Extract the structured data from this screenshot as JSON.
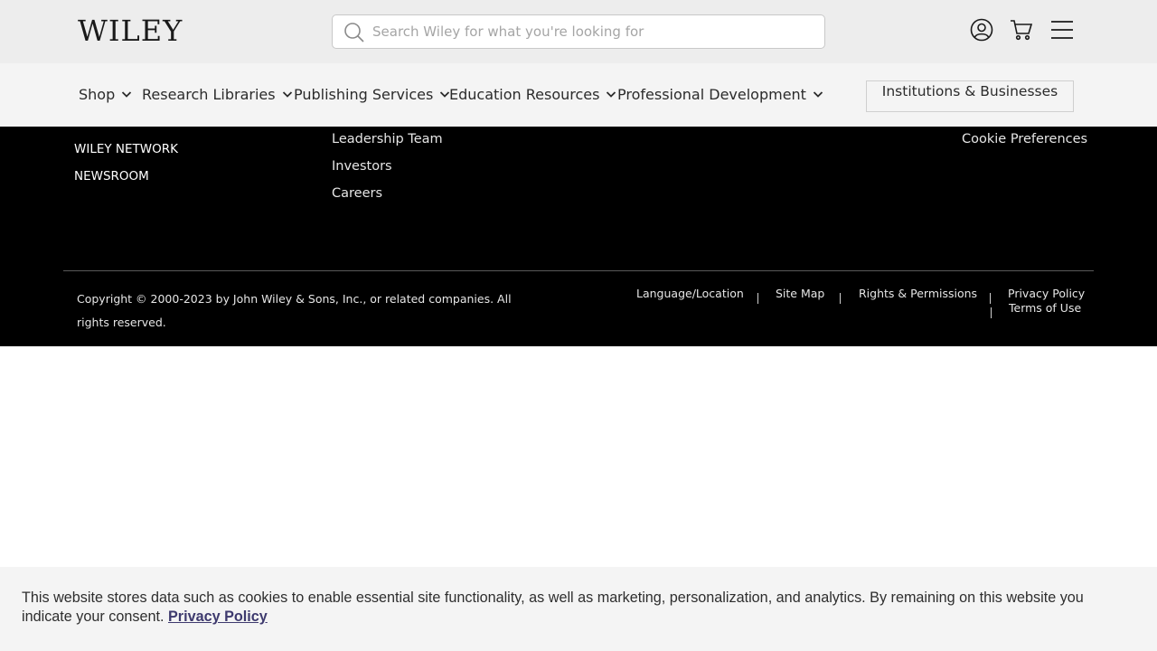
{
  "header": {
    "logo_text": "WILEY",
    "search": {
      "placeholder": "Search Wiley for what you're looking for",
      "value": ""
    },
    "icons": [
      "account-icon",
      "cart-icon",
      "menu-icon"
    ]
  },
  "nav": {
    "items": [
      {
        "label": "Shop"
      },
      {
        "label": "Research Libraries"
      },
      {
        "label": "Publishing Services"
      },
      {
        "label": "Education Resources"
      },
      {
        "label": "Professional Development"
      }
    ],
    "institutions_button": "Institutions & Businesses"
  },
  "footer": {
    "col1": [
      "WILEY NETWORK",
      "NEWSROOM"
    ],
    "col2": [
      "Leadership Team",
      "Investors",
      "Careers"
    ],
    "col4": [
      "Cookie Preferences"
    ],
    "copyright": "Copyright © 2000-2023 by John Wiley & Sons, Inc., or related companies. All rights reserved.",
    "legal_links": [
      "Language/Location",
      "Site Map",
      "Rights & Permissions",
      "Privacy Policy",
      "Terms of Use"
    ]
  },
  "cookie_banner": {
    "text": "This website stores data such as cookies to enable essential site functionality, as well as marketing, personalization, and analytics. By remaining on this website you indicate your consent.",
    "link_label": "Privacy Policy"
  },
  "colors": {
    "header_bg": "#ededed",
    "nav_bg": "#f4f4f4",
    "footer_bg": "#000000",
    "cookie_link": "#3e3a6e"
  }
}
